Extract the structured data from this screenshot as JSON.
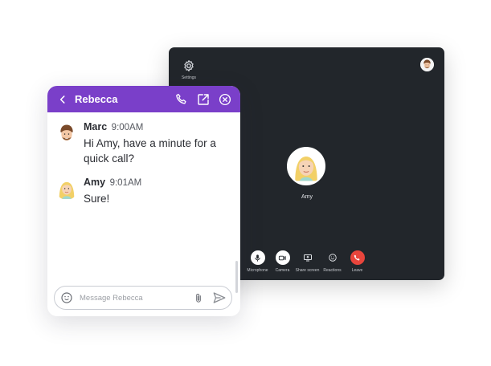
{
  "call": {
    "settings_label": "Settings",
    "participant_name": "Amy",
    "controls": [
      {
        "label": "Microphone",
        "icon": "microphone-icon"
      },
      {
        "label": "Camera",
        "icon": "camera-icon"
      },
      {
        "label": "Share screen",
        "icon": "share-screen-icon"
      },
      {
        "label": "Reactions",
        "icon": "smiley-icon"
      },
      {
        "label": "Leave",
        "icon": "phone-hangup-icon"
      }
    ],
    "colors": {
      "background": "#22262b",
      "leave": "#e8453c"
    }
  },
  "chat": {
    "header": {
      "title": "Rebecca",
      "icons": [
        "back-icon",
        "phone-icon",
        "popout-icon",
        "close-icon"
      ]
    },
    "messages": [
      {
        "author": "Marc",
        "time": "9:00AM",
        "text": "Hi Amy, have a minute for a quick call?"
      },
      {
        "author": "Amy",
        "time": "9:01AM",
        "text": "Sure!"
      }
    ],
    "input": {
      "placeholder": "Message Rebecca",
      "value": ""
    },
    "colors": {
      "header": "#7a3fc9"
    }
  }
}
